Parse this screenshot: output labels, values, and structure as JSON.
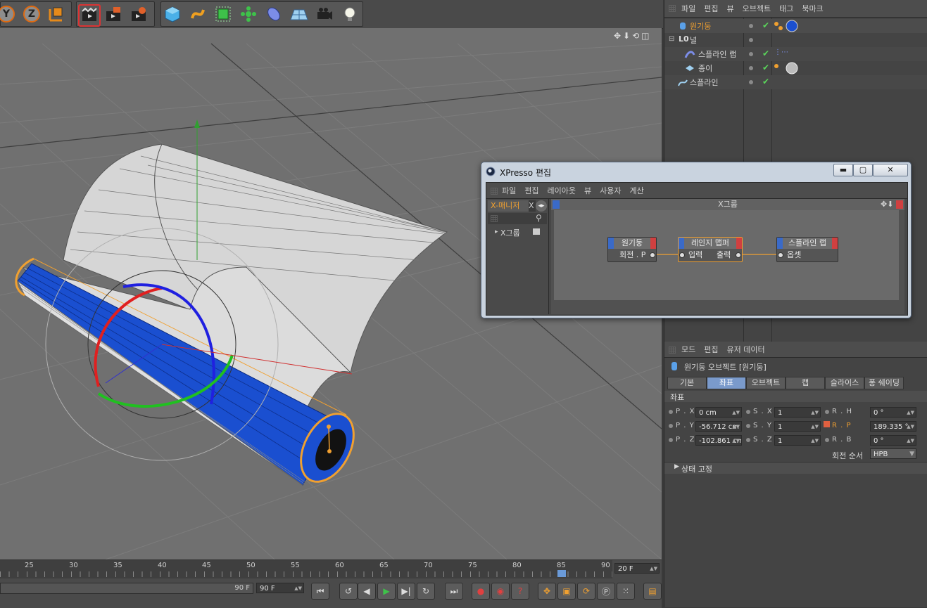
{
  "toolbar": {
    "axis_buttons": [
      "Y",
      "Z"
    ],
    "icons": [
      "coordinate-system-icon",
      "render-view-icon",
      "render-picture-icon",
      "render-settings-icon",
      "cube-icon",
      "spline-pen-icon",
      "nurbs-icon",
      "array-icon",
      "deformer-icon",
      "floor-icon",
      "camera-icon",
      "light-icon"
    ]
  },
  "object_manager": {
    "menu": [
      "파일",
      "편집",
      "뷰",
      "오브젝트",
      "태그",
      "북마크"
    ],
    "objects": [
      {
        "name": "원기둥",
        "icon": "cylinder-icon",
        "selected": true
      },
      {
        "name": "널",
        "icon": "null-icon"
      },
      {
        "name": "스플라인 랩",
        "icon": "spline-wrap-icon"
      },
      {
        "name": "종이",
        "icon": "plane-icon"
      },
      {
        "name": "스플라인",
        "icon": "spline-icon"
      }
    ]
  },
  "xpresso": {
    "title": "XPresso 편집",
    "menu": [
      "파일",
      "편집",
      "레이아웃",
      "뷰",
      "사용자",
      "계산"
    ],
    "tab": "X-매니저",
    "tab2": "X",
    "group_title": "X그룹",
    "tree_item": "X그룹",
    "nodes": [
      {
        "title": "원기둥",
        "port": "회전 . P"
      },
      {
        "title": "레인지 맵퍼",
        "port_in": "입력",
        "port_out": "출력"
      },
      {
        "title": "스플라인 랩",
        "port": "옵셋"
      }
    ],
    "win_buttons": [
      "▬",
      "▢",
      "✕"
    ]
  },
  "attributes": {
    "menu": [
      "모드",
      "편집",
      "유저 데이터"
    ],
    "object_title": "원기둥 오브젝트 [원기둥]",
    "tabs": [
      "기본",
      "좌표",
      "오브젝트",
      "캡",
      "슬라이스",
      "퐁 쉐이딩"
    ],
    "active_tab": "좌표",
    "section": "좌표",
    "fields": {
      "px_label": "P . X",
      "px": "0 cm",
      "py_label": "P . Y",
      "py": "-56.712 cm",
      "pz_label": "P . Z",
      "pz": "-102.861 cm",
      "sx_label": "S . X",
      "sx": "1",
      "sy_label": "S . Y",
      "sy": "1",
      "sz_label": "S . Z",
      "sz": "1",
      "rh_label": "R . H",
      "rh": "0 °",
      "rp_label": "R . P",
      "rp": "189.335 °",
      "rb_label": "R . B",
      "rb": "0 °"
    },
    "rotation_order_label": "회전 순서",
    "rotation_order": "HPB",
    "freeze_section": "상태 고정"
  },
  "timeline": {
    "ticks": [
      "25",
      "30",
      "35",
      "40",
      "45",
      "50",
      "55",
      "60",
      "65",
      "70",
      "75",
      "80",
      "85",
      "90"
    ],
    "current_frame": "20 F",
    "end_frame_slider": "90 F",
    "end_frame": "90 F"
  },
  "colors": {
    "accent_orange": "#f0a030",
    "selection_blue": "#7a9acb",
    "cylinder_blue": "#1a4fd0"
  }
}
